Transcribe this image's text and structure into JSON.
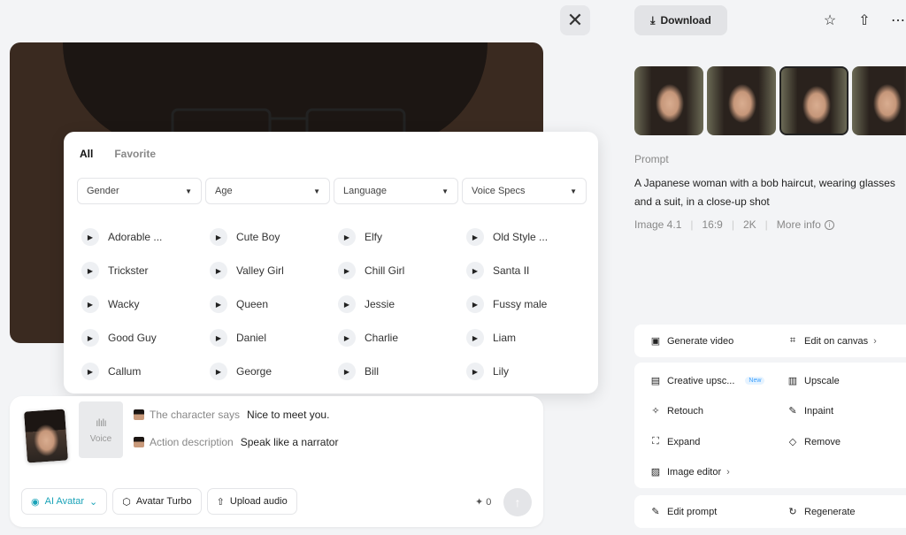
{
  "left": {
    "close_label": "✕",
    "voice_popover": {
      "tabs": [
        {
          "label": "All",
          "active": true
        },
        {
          "label": "Favorite",
          "active": false
        }
      ],
      "filters": [
        "Gender",
        "Age",
        "Language",
        "Voice Specs"
      ],
      "voices": [
        "Adorable ...",
        "Cute Boy",
        "Elfy",
        "Old Style ...",
        "Trickster",
        "Valley Girl",
        "Chill Girl",
        "Santa II",
        "Wacky",
        "Queen",
        "Jessie",
        "Fussy male",
        "Good Guy",
        "Daniel",
        "Charlie",
        "Liam",
        "Callum",
        "George",
        "Bill",
        "Lily"
      ]
    },
    "composer": {
      "voice_card_label": "Voice",
      "character_says_label": "The character says",
      "character_says_value": "Nice to meet you.",
      "action_label": "Action description",
      "action_value": "Speak like a narrator",
      "ai_avatar_label": "AI Avatar",
      "avatar_turbo_label": "Avatar Turbo",
      "upload_audio_label": "Upload audio",
      "credits": "0"
    }
  },
  "right": {
    "download_label": "Download",
    "prompt_label": "Prompt",
    "prompt_text": "A Japanese woman with a bob haircut, wearing glasses and a suit, in a close-up shot",
    "meta": {
      "model": "Image 4.1",
      "ratio": "16:9",
      "resolution": "2K",
      "more_info": "More info"
    },
    "actions": {
      "generate_video": "Generate video",
      "edit_on_canvas": "Edit on canvas",
      "creative_upscale": "Creative upsc...",
      "new_badge": "New",
      "upscale": "Upscale",
      "retouch": "Retouch",
      "inpaint": "Inpaint",
      "expand": "Expand",
      "remove": "Remove",
      "image_editor": "Image editor",
      "edit_prompt": "Edit prompt",
      "regenerate": "Regenerate"
    }
  },
  "colors": {
    "accent": "#1aa3b8",
    "background": "#f3f4f6",
    "card": "#ffffff"
  }
}
